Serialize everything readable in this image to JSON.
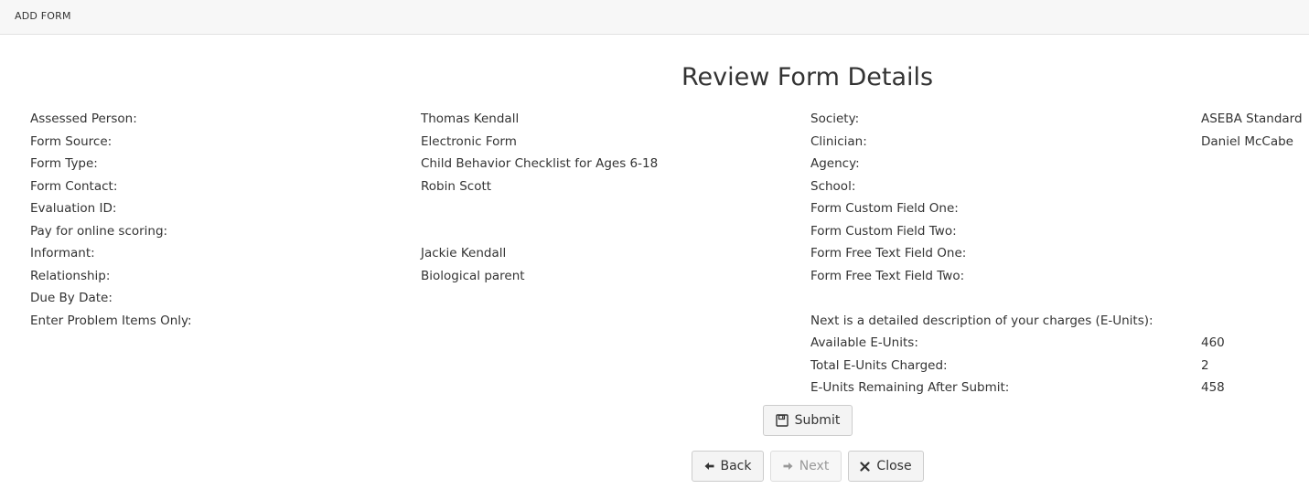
{
  "header": {
    "breadcrumb": "ADD FORM"
  },
  "page_title": "Review Form Details",
  "left_fields": [
    {
      "label": "Assessed Person:",
      "value": "Thomas Kendall"
    },
    {
      "label": "Form Source:",
      "value": "Electronic Form"
    },
    {
      "label": "Form Type:",
      "value": "Child Behavior Checklist for Ages 6-18"
    },
    {
      "label": "Form Contact:",
      "value": "Robin Scott"
    },
    {
      "label": "Evaluation ID:",
      "value": ""
    },
    {
      "label": "Pay for online scoring:",
      "value": ""
    },
    {
      "label": "Informant:",
      "value": "Jackie Kendall"
    },
    {
      "label": "Relationship:",
      "value": "Biological parent"
    },
    {
      "label": "Due By Date:",
      "value": ""
    },
    {
      "label": "Enter Problem Items Only:",
      "value": ""
    }
  ],
  "right_fields": [
    {
      "label": "Society:",
      "value": "ASEBA Standard"
    },
    {
      "label": "Clinician:",
      "value": "Daniel McCabe"
    },
    {
      "label": "Agency:",
      "value": ""
    },
    {
      "label": "School:",
      "value": ""
    },
    {
      "label": "Form Custom Field One:",
      "value": ""
    },
    {
      "label": "Form Custom Field Two:",
      "value": ""
    },
    {
      "label": "Form Free Text Field One:",
      "value": ""
    },
    {
      "label": "Form Free Text Field Two:",
      "value": ""
    }
  ],
  "charges": {
    "intro": "Next is a detailed description of your charges (E-Units):",
    "rows": [
      {
        "label": "Available E-Units:",
        "value": "460"
      },
      {
        "label": "Total E-Units Charged:",
        "value": "2"
      },
      {
        "label": "E-Units Remaining After Submit:",
        "value": "458"
      }
    ]
  },
  "buttons": {
    "submit": "Submit",
    "back": "Back",
    "next": "Next",
    "close": "Close"
  },
  "icons": {
    "submit": "floppy-disk-icon",
    "back": "arrow-left-icon",
    "next": "arrow-right-icon",
    "close": "close-icon"
  }
}
